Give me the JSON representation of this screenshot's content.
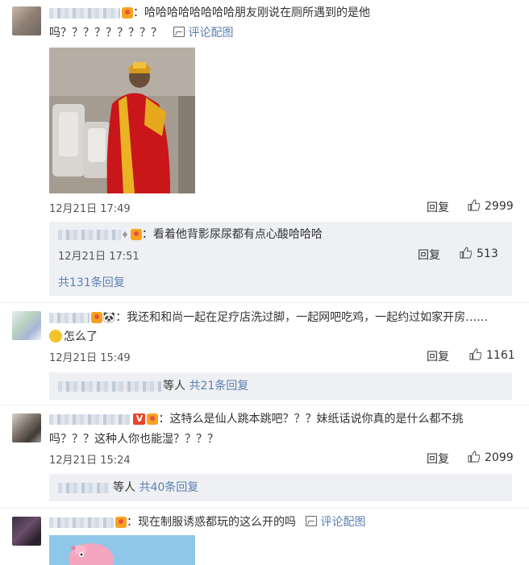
{
  "comments": [
    {
      "text_line1": "：哈哈哈哈哈哈哈哈朋友刚说在厕所遇到的是他",
      "text_line2": "吗？？？？？？？？？",
      "pic_label": "评论配图",
      "time": "12月21日 17:49",
      "reply_label": "回复",
      "likes": "2999",
      "sub_reply": {
        "text": "：看着他背影尿尿都有点心酸哈哈哈",
        "time": "12月21日 17:51",
        "reply_label": "回复",
        "likes": "513"
      },
      "more": "共131条回复"
    },
    {
      "text_line1": "：我还和和尚一起在足疗店洗过脚，一起网吧吃鸡，一起约过如家开房……",
      "text_line2": "怎么了",
      "time": "12月21日 15:49",
      "reply_label": "回复",
      "likes": "1161",
      "more_prefix": "等人",
      "more": "共21条回复"
    },
    {
      "vip_badge": "V",
      "text_line1": "：这特么是仙人跳本跳吧？？？妹纸话说你真的是什么都不挑",
      "text_line2": "吗？？？这种人你也能湿？？？？",
      "time": "12月21日 15:24",
      "reply_label": "回复",
      "likes": "2099",
      "more_prefix": "等人",
      "more": "共40条回复"
    },
    {
      "text_line1": "：现在制服诱惑都玩的这么开的吗",
      "pic_label": "评论配图"
    }
  ],
  "colors": {
    "link": "#eb7350",
    "sub_bg": "#eef0f3",
    "name_blur": "#cfd6e3"
  },
  "icons": [
    "thumb-up-icon",
    "picture-icon",
    "vip-badge-icon",
    "member-badge-icon"
  ]
}
